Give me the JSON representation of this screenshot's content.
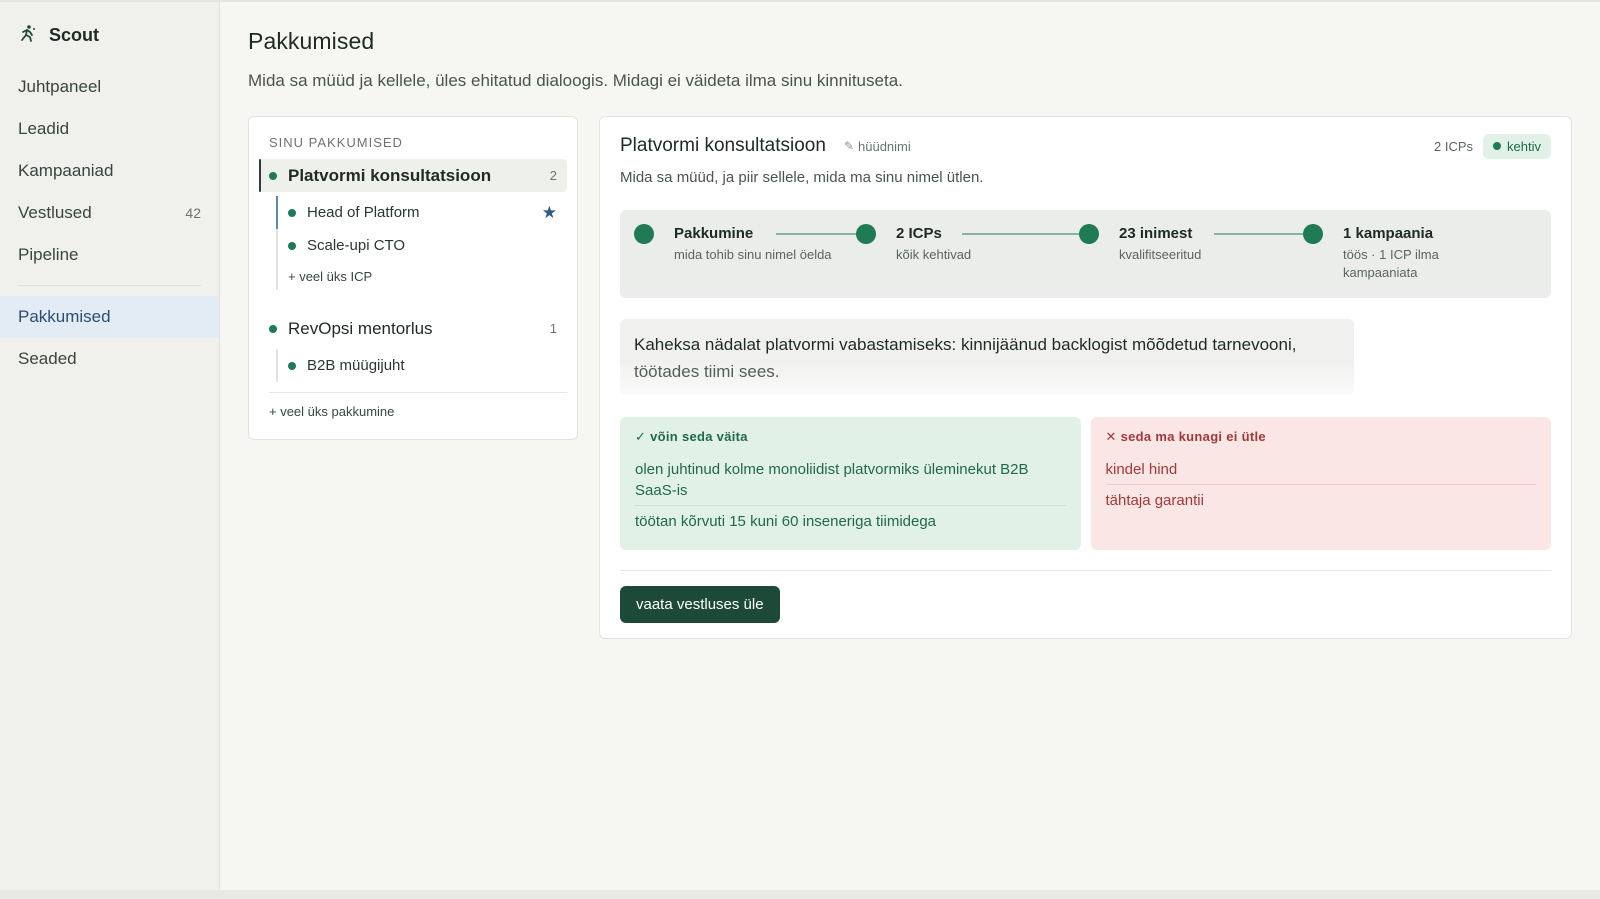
{
  "brand": {
    "name": "Scout"
  },
  "nav": {
    "items": [
      {
        "label": "Juhtpaneel"
      },
      {
        "label": "Leadid"
      },
      {
        "label": "Kampaaniad"
      },
      {
        "label": "Vestlused",
        "count": "42"
      },
      {
        "label": "Pipeline"
      }
    ],
    "secondary": [
      {
        "label": "Pakkumised",
        "active": true
      },
      {
        "label": "Seaded"
      }
    ]
  },
  "page": {
    "title": "Pakkumised",
    "subtitle": "Mida sa müüd ja kellele, üles ehitatud dialoogis. Midagi ei väideta ilma sinu kinnituseta."
  },
  "offers": {
    "section_label": "SINU PAKKUMISED",
    "list": [
      {
        "name": "Platvormi konsultatsioon",
        "count": "2",
        "icps": [
          {
            "name": "Head of Platform",
            "starred": true
          },
          {
            "name": "Scale-upi CTO"
          }
        ],
        "add_icp": "+ veel üks ICP"
      },
      {
        "name": "RevOpsi mentorlus",
        "count": "1",
        "icps": [
          {
            "name": "B2B müügijuht"
          }
        ]
      }
    ],
    "add_offer": "+ veel üks pakkumine"
  },
  "detail": {
    "title": "Platvormi konsultatsioon",
    "alias_icon": "pencil-icon",
    "alias": "hüüdnimi",
    "icp_count": "2 ICPs",
    "status": "kehtiv",
    "description": "Mida sa müüd, ja piir sellele, mida ma sinu nimel ütlen.",
    "steps": [
      {
        "title": "Pakkumine",
        "sub": "mida tohib sinu nimel öelda"
      },
      {
        "title": "2 ICPs",
        "sub": "kõik kehtivad"
      },
      {
        "title": "23 inimest",
        "sub": "kvalifitseeritud"
      },
      {
        "title": "1 kampaania",
        "sub": "töös · 1 ICP ilma",
        "sub2": "kampaaniata"
      }
    ],
    "pitch_line1": "Kaheksa nädalat platvormi vabastamiseks: kinnijäänud backlogist mõõdetud tarnevooni,",
    "pitch_line2": "töötades tiimi sees.",
    "can_say": {
      "heading": "✓ võin seda väita",
      "items": [
        "olen juhtinud kolme monoliidist platvormiks üleminekut B2B SaaS-is",
        "töötan kõrvuti 15 kuni 60 inseneriga tiimidega"
      ]
    },
    "never_say": {
      "heading": "✕ seda ma kunagi ei ütle",
      "items": [
        "kindel hind",
        "tähtaja garantii"
      ]
    },
    "cta": "vaata vestluses üle"
  },
  "colors": {
    "accent": "#1f7a55",
    "cta": "#1d4a38",
    "active_nav": "#e3ebf4",
    "positive_bg": "#e2f1e8",
    "negative_bg": "#fbe6e6"
  }
}
